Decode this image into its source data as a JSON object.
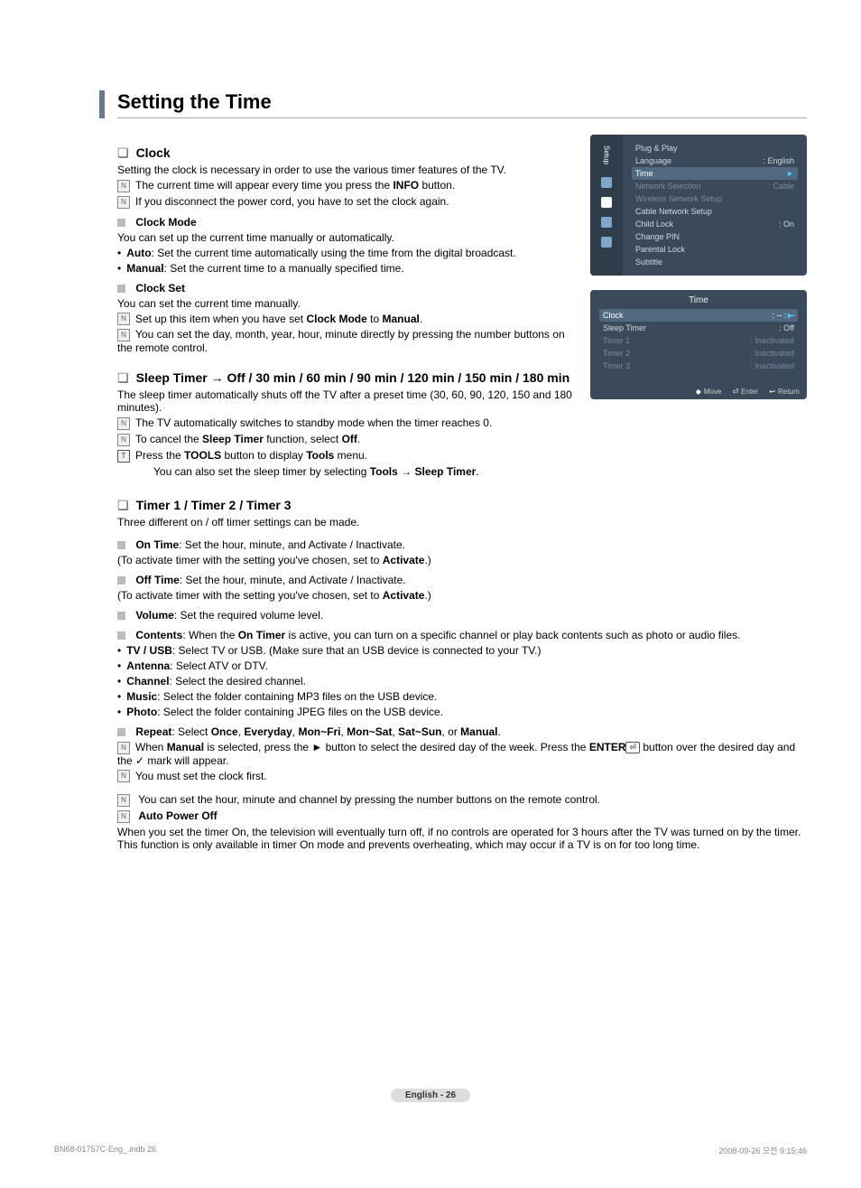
{
  "title": "Setting the Time",
  "sections": {
    "clock": {
      "heading": "Clock",
      "desc": "Setting the clock is necessary in order to use the various timer features of the TV.",
      "notes": [
        "The current time will appear every time you press the <b>INFO</b> button.",
        "If you disconnect the power cord, you have to set the clock again."
      ],
      "clock_mode": {
        "label": "Clock Mode",
        "desc": "You can set up the current time manually or automatically.",
        "auto_label": "Auto",
        "auto_text": ": Set the current time automatically using the time from the digital broadcast.",
        "manual_label": "Manual",
        "manual_text": ": Set the current time to a manually specified time."
      },
      "clock_set": {
        "label": "Clock Set",
        "desc": "You can set the current time manually.",
        "note1": "Set up this item when you have set <b>Clock Mode</b> to <b>Manual</b>.",
        "note2": "You can set the day, month, year, hour, minute directly by pressing the number buttons on the remote control."
      }
    },
    "sleep_timer": {
      "heading": "Sleep Timer → Off / 30 min / 60 min / 90 min / 120 min / 150 min / 180 min",
      "desc": "The sleep timer automatically shuts off the TV after a preset time (30, 60, 90, 120, 150 and 180 minutes).",
      "note1": "The TV automatically switches to standby mode when the timer reaches 0.",
      "note2": "To cancel the <b>Sleep Timer</b> function, select <b>Off</b>.",
      "tool1": "Press the <b>TOOLS</b> button to display <b>Tools</b> menu.",
      "tool2": "You can also set the sleep timer by selecting <b>Tools → Sleep Timer</b>."
    },
    "timers": {
      "heading": "Timer 1 / Timer 2 / Timer 3",
      "desc": "Three different on / off timer settings can be made.",
      "on_time": "<b>On Time</b>: Set the hour, minute, and Activate / Inactivate.",
      "on_time_sub": "(To activate timer with the setting you've chosen, set to <b>Activate</b>.)",
      "off_time": "<b>Off Time</b>: Set the hour, minute, and Activate / Inactivate.",
      "off_time_sub": "(To activate timer with the setting you've chosen, set to <b>Activate</b>.)",
      "volume": "<b>Volume</b>: Set the required volume level.",
      "contents": "<b>Contents</b>: When the <b>On Timer</b> is active, you can turn on a specific channel or play back contents such as photo or audio files.",
      "sub": {
        "tvusb": "<b>TV / USB</b>: Select TV or USB. (Make sure that an USB device is connected to your TV.)",
        "antenna": "<b>Antenna</b>: Select ATV or DTV.",
        "channel": "<b>Channel</b>: Select the desired channel.",
        "music": "<b>Music</b>: Select the folder containing MP3 files on the USB device.",
        "photo": "<b>Photo</b>: Select the folder containing JPEG files on the USB device."
      },
      "repeat": "<b>Repeat</b>: Select <b>Once</b>, <b>Everyday</b>, <b>Mon~Fri</b>, <b>Mon~Sat</b>, <b>Sat~Sun</b>, or <b>Manual</b>.",
      "repeat_note": "When <b>Manual</b> is selected, press the ► button to select the desired day of the week. Press the <b>ENTER</b><span class='enter-glyph'>⏎</span> button over the desired day and the <span class='check'>✓</span> mark will appear.",
      "repeat_note2": "You must set the clock first.",
      "bottom_note": "You can set the hour, minute and channel by pressing the number buttons on the remote control.",
      "auto_off_label": "Auto Power Off",
      "auto_off_text": "When you set the timer On, the television will eventually turn off, if no controls are operated for 3 hours after the TV was turned on by the timer. This function is only available in timer On mode and prevents overheating, which may occur if a TV is on for too long time."
    }
  },
  "osd_setup": {
    "sidebar_label": "Setup",
    "items": [
      {
        "label": "Plug & Play",
        "value": "",
        "dim": false,
        "hl": false
      },
      {
        "label": "Language",
        "value": ": English",
        "dim": false,
        "hl": false
      },
      {
        "label": "Time",
        "value": "",
        "dim": false,
        "hl": true
      },
      {
        "label": "Network Selection",
        "value": ": Cable",
        "dim": true,
        "hl": false
      },
      {
        "label": "Wireless Network Setup",
        "value": "",
        "dim": true,
        "hl": false
      },
      {
        "label": "Cable Network Setup",
        "value": "",
        "dim": false,
        "hl": false
      },
      {
        "label": "Child Lock",
        "value": ": On",
        "dim": false,
        "hl": false
      },
      {
        "label": "Change PIN",
        "value": "",
        "dim": false,
        "hl": false
      },
      {
        "label": "Parental Lock",
        "value": "",
        "dim": false,
        "hl": false
      },
      {
        "label": "Subtitle",
        "value": "",
        "dim": false,
        "hl": false
      }
    ]
  },
  "osd_time": {
    "title": "Time",
    "rows": [
      {
        "label": "Clock",
        "value": ": -- : --",
        "dim": false,
        "hl": true
      },
      {
        "label": "Sleep Timer",
        "value": ": Off",
        "dim": false,
        "hl": false
      },
      {
        "label": "Timer 1",
        "value": ": Inactivated",
        "dim": true,
        "hl": false
      },
      {
        "label": "Timer 2",
        "value": ": Inactivated",
        "dim": true,
        "hl": false
      },
      {
        "label": "Timer 3",
        "value": ": Inactivated",
        "dim": true,
        "hl": false
      }
    ],
    "foot": {
      "move": "Move",
      "enter": "Enter",
      "return": "Return"
    }
  },
  "footer": {
    "page": "English - 26"
  },
  "print": {
    "left": "BN68-01757C-Eng_.indb   26",
    "right": "2008-09-26   오전 9:15:46"
  }
}
